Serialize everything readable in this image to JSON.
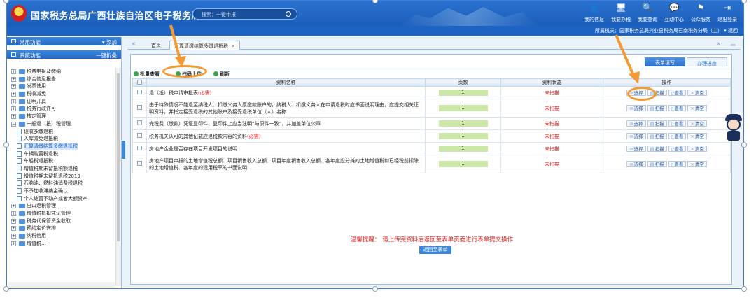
{
  "header": {
    "site_title": "国家税务总局广西壮族自治区电子税务局",
    "search_placeholder": "搜索：一键申报",
    "nav": [
      {
        "icon": "user-icon",
        "glyph": "👤",
        "label": "我的信息"
      },
      {
        "icon": "computer-icon",
        "glyph": "🖥",
        "label": "我要办税"
      },
      {
        "icon": "magnifier-doc-icon",
        "glyph": "🔍",
        "label": "我要查询"
      },
      {
        "icon": "chat-icon",
        "glyph": "💬",
        "label": "互动中心"
      },
      {
        "icon": "public-service-icon",
        "glyph": "⚑",
        "label": "公众服务"
      },
      {
        "icon": "logout-icon",
        "glyph": "⇥",
        "label": "退出登录"
      }
    ],
    "tax_office_label": "所属机关：",
    "tax_office": "国家税务总局兴业县税务局石南税务分局（主）",
    "return_link": "返回"
  },
  "left": {
    "common_title": "常用功能",
    "add_label": "添加",
    "system_title": "系统功能",
    "collapse_label": "一键折叠",
    "tree": [
      {
        "type": "folder",
        "depth": 0,
        "label": "税费申报及缴纳"
      },
      {
        "type": "folder",
        "depth": 0,
        "label": "综合信息报告"
      },
      {
        "type": "folder",
        "depth": 0,
        "label": "发票使用"
      },
      {
        "type": "folder",
        "depth": 0,
        "label": "税收减免"
      },
      {
        "type": "folder",
        "depth": 0,
        "label": "证明开具"
      },
      {
        "type": "folder",
        "depth": 0,
        "label": "税务行政许可"
      },
      {
        "type": "folder",
        "depth": 0,
        "label": "核定管理"
      },
      {
        "type": "folder",
        "depth": 0,
        "label": "一般退（抵）税管理",
        "expanded": true
      },
      {
        "type": "doc",
        "depth": 1,
        "label": "误收多缴退税"
      },
      {
        "type": "doc",
        "depth": 1,
        "label": "入库减免退抵税"
      },
      {
        "type": "doc",
        "depth": 1,
        "label": "汇算清缴结算多缴退抵税",
        "selected": true
      },
      {
        "type": "doc",
        "depth": 1,
        "label": "车辆购置税退税"
      },
      {
        "type": "doc",
        "depth": 1,
        "label": "车船税退抵税"
      },
      {
        "type": "doc",
        "depth": 1,
        "label": "增值税期末留抵税额退税"
      },
      {
        "type": "doc",
        "depth": 1,
        "label": "增值税期末留抵退税2019"
      },
      {
        "type": "doc",
        "depth": 1,
        "label": "石脑油、燃料油消费税退税"
      },
      {
        "type": "doc",
        "depth": 1,
        "label": "不予加收滞纳金确认"
      },
      {
        "type": "doc",
        "depth": 1,
        "label": "个人处置不动产或者大额资产"
      },
      {
        "type": "folder",
        "depth": 0,
        "label": "出口退税管理"
      },
      {
        "type": "folder",
        "depth": 0,
        "label": "增值税抵扣凭证管理"
      },
      {
        "type": "folder",
        "depth": 0,
        "label": "税务代保管资金收取"
      },
      {
        "type": "folder",
        "depth": 0,
        "label": "预约定价安排"
      },
      {
        "type": "folder",
        "depth": 0,
        "label": "纳税信用"
      },
      {
        "type": "folder",
        "depth": 0,
        "label": "增值税..."
      }
    ]
  },
  "tabs": {
    "home": "首页",
    "active": "汇算清缴结算多缴退抵税"
  },
  "subtabs": {
    "fill": "表单填写",
    "progress": "办理进度"
  },
  "toolbar": {
    "batch_view": "批量查看",
    "scan_upload": "扫码上传",
    "refresh": "刷新"
  },
  "table": {
    "columns": [
      "资料名称",
      "页数",
      "资料状态",
      "操作"
    ],
    "ops": [
      "选择",
      "扫描",
      "查看",
      "清空"
    ],
    "rows": [
      {
        "name": "退（抵）税申请审批表",
        "required": "(必需)",
        "pages": "1",
        "status": "未扫描",
        "tall": false
      },
      {
        "name": "由于特殊情况不能退至纳税人、扣缴义务人原缴款账户的，纳税人、扣缴义务人在申请退税时应书面说明理由，应提交相关证明资料，并指定接受退税的其他账户及接受退税单位（人）名称",
        "required": "",
        "pages": "1",
        "status": "未扫描",
        "tall": true
      },
      {
        "name": "完税费（缴款）凭证复印件，复印件上应当注明“与原件一致”，并加盖单位公章",
        "required": "",
        "pages": "1",
        "status": "未扫描",
        "tall": false
      },
      {
        "name": "税务机关认可的其他记载应退税款内容的资料",
        "required": "(必需)",
        "pages": "1",
        "status": "未扫描",
        "tall": false
      },
      {
        "name": "房地产企业是否存在项目开发项目的说明",
        "required": "",
        "pages": "1",
        "status": "未扫描",
        "tall": false
      },
      {
        "name": "房地产项目申报的土地增值税总额、项目销售收入总额、项目年度销售收入总额、各年度应分摊的土地增值税和已经税前扣除的土地增值税、各年度的适用税率的书面说明",
        "required": "",
        "pages": "1",
        "status": "未扫描",
        "tall": true
      }
    ]
  },
  "hint": "温馨提醒：  请上传完资料后返回至表单页面进行表单提交操作",
  "return_button": "返回至表单",
  "colors": {
    "accent": "#2c70cd",
    "annotation": "#f39a32",
    "status_red": "#e01d1d"
  }
}
